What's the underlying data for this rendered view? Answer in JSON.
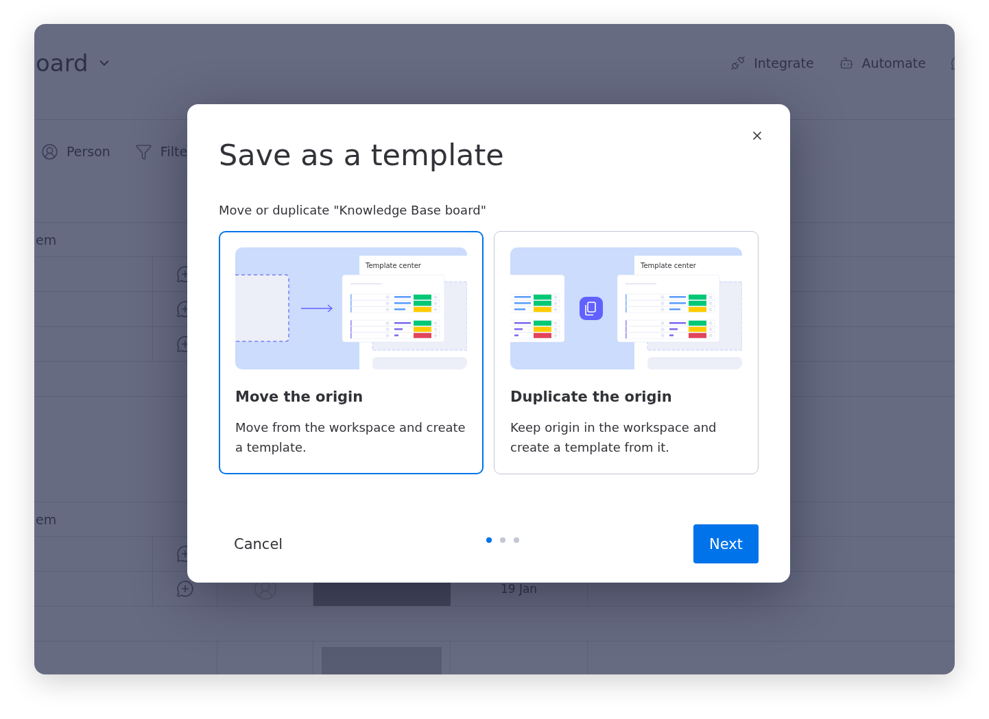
{
  "board": {
    "title": "oard",
    "actions": [
      {
        "kind": "integrate",
        "label": "Integrate"
      },
      {
        "kind": "automate",
        "label": "Automate"
      },
      {
        "kind": "chat"
      }
    ],
    "filters": [
      {
        "kind": "person",
        "label": "Person"
      },
      {
        "kind": "filter",
        "label": "Filte"
      }
    ],
    "groups": [
      {
        "label": "em",
        "rows": [
          {
            "kind": "item"
          },
          {
            "kind": "item"
          },
          {
            "kind": "item"
          },
          {
            "kind": "add"
          }
        ]
      },
      {
        "label": "em",
        "rows": [
          {
            "kind": "item"
          },
          {
            "kind": "item",
            "filled": true,
            "date": "19 Jan"
          },
          {
            "kind": "add"
          }
        ]
      }
    ],
    "footer": {
      "kind": "summary"
    }
  },
  "modal": {
    "title": "Save as a template",
    "subtitle": "Move or duplicate \"Knowledge Base board\"",
    "options": [
      {
        "kind": "move",
        "selected": true,
        "panel_label": "Template center",
        "title": "Move the origin",
        "description": "Move from the workspace and create a template."
      },
      {
        "kind": "duplicate",
        "selected": false,
        "panel_label": "Template center",
        "title": "Duplicate the origin",
        "description": "Keep origin in the workspace and create a template from it."
      }
    ],
    "steps": [
      {
        "selected": true
      },
      {
        "selected": false
      },
      {
        "selected": false
      }
    ],
    "cancel": "Cancel",
    "next": "Next"
  }
}
